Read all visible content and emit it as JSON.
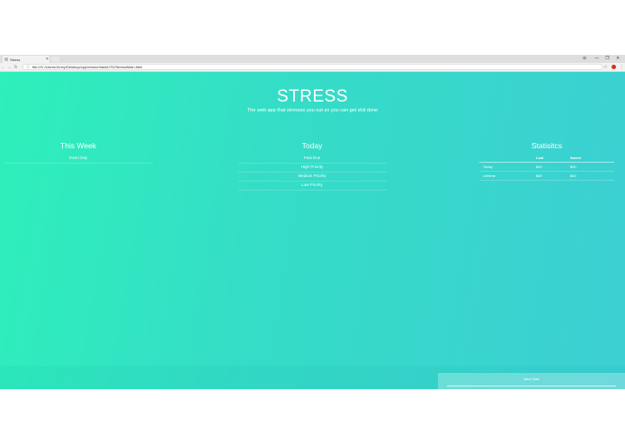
{
  "browser": {
    "tab_title": "Stress",
    "tab_close": "×",
    "url": "file:///C:/Users/Jenny/Desktop/cpp/ehome/hackUTD/Stress/Main.html",
    "window_controls": [
      "⊖",
      "—",
      "❐",
      "✕"
    ]
  },
  "page": {
    "title": "STRESS",
    "subtitle": "The web app that stresses you out so you can get shit done"
  },
  "this_week": {
    "title": "This Week",
    "items": [
      "Insert Day"
    ]
  },
  "today": {
    "title": "Today",
    "items": [
      "Past Due",
      "High Priority",
      "Medium Priority",
      "Low Priority"
    ]
  },
  "statistics": {
    "title": "Statisitcs",
    "headers": [
      "",
      "Lost",
      "Saved"
    ],
    "rows": [
      {
        "label": "Today",
        "lost": "$00",
        "saved": "$00"
      },
      {
        "label": "Lifetime",
        "lost": "$00",
        "saved": "$00"
      }
    ]
  },
  "footer": {
    "new_task_label": "New Task"
  },
  "colors": {
    "gradient_start": "#2ef0bb",
    "gradient_end": "#3ccfd3"
  }
}
